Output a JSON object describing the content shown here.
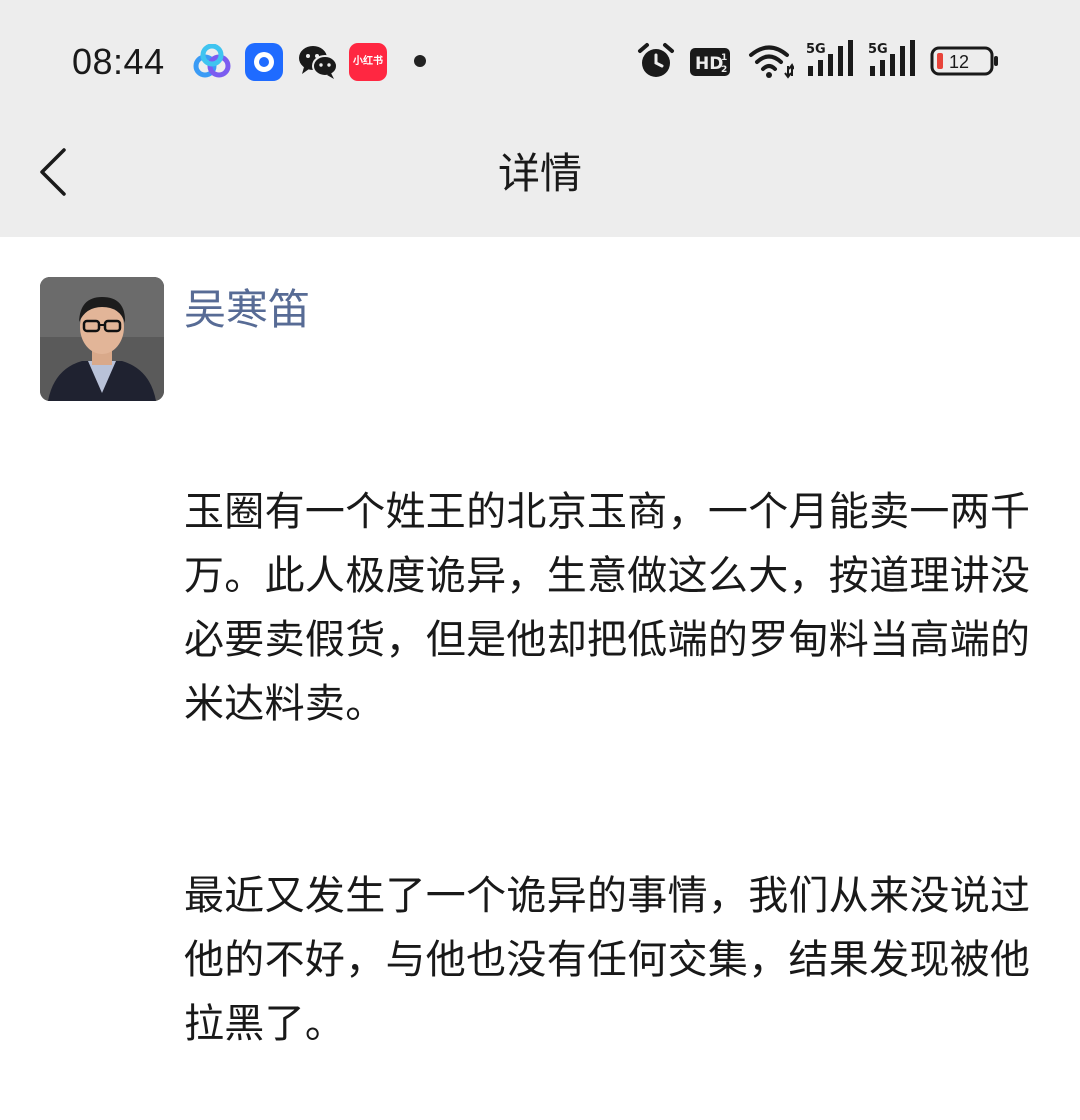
{
  "status_bar": {
    "time": "08:44",
    "notification_icons": [
      "baidu-netdisk-icon",
      "blue-app-icon",
      "wechat-icon",
      "xiaohongshu-icon",
      "more-dot-icon"
    ],
    "xiaohongshu_label": "小红书",
    "hd_label": "HD",
    "network_labels": [
      "5G",
      "5G"
    ],
    "battery_level": "12",
    "battery_color": "#e8443a"
  },
  "nav": {
    "title": "详情"
  },
  "post": {
    "author": "吴寒笛",
    "paragraphs": [
      "玉圈有一个姓王的北京玉商，一个月能卖一两千万。此人极度诡异，生意做这么大，按道理讲没必要卖假货，但是他却把低端的罗甸料当高端的米达料卖。",
      "最近又发生了一个诡异的事情，我们从来没说过他的不好，与他也没有任何交集，结果发现被他拉黑了。"
    ]
  },
  "colors": {
    "top_background": "#ededed",
    "author_link": "#576b95",
    "text": "#191919"
  }
}
